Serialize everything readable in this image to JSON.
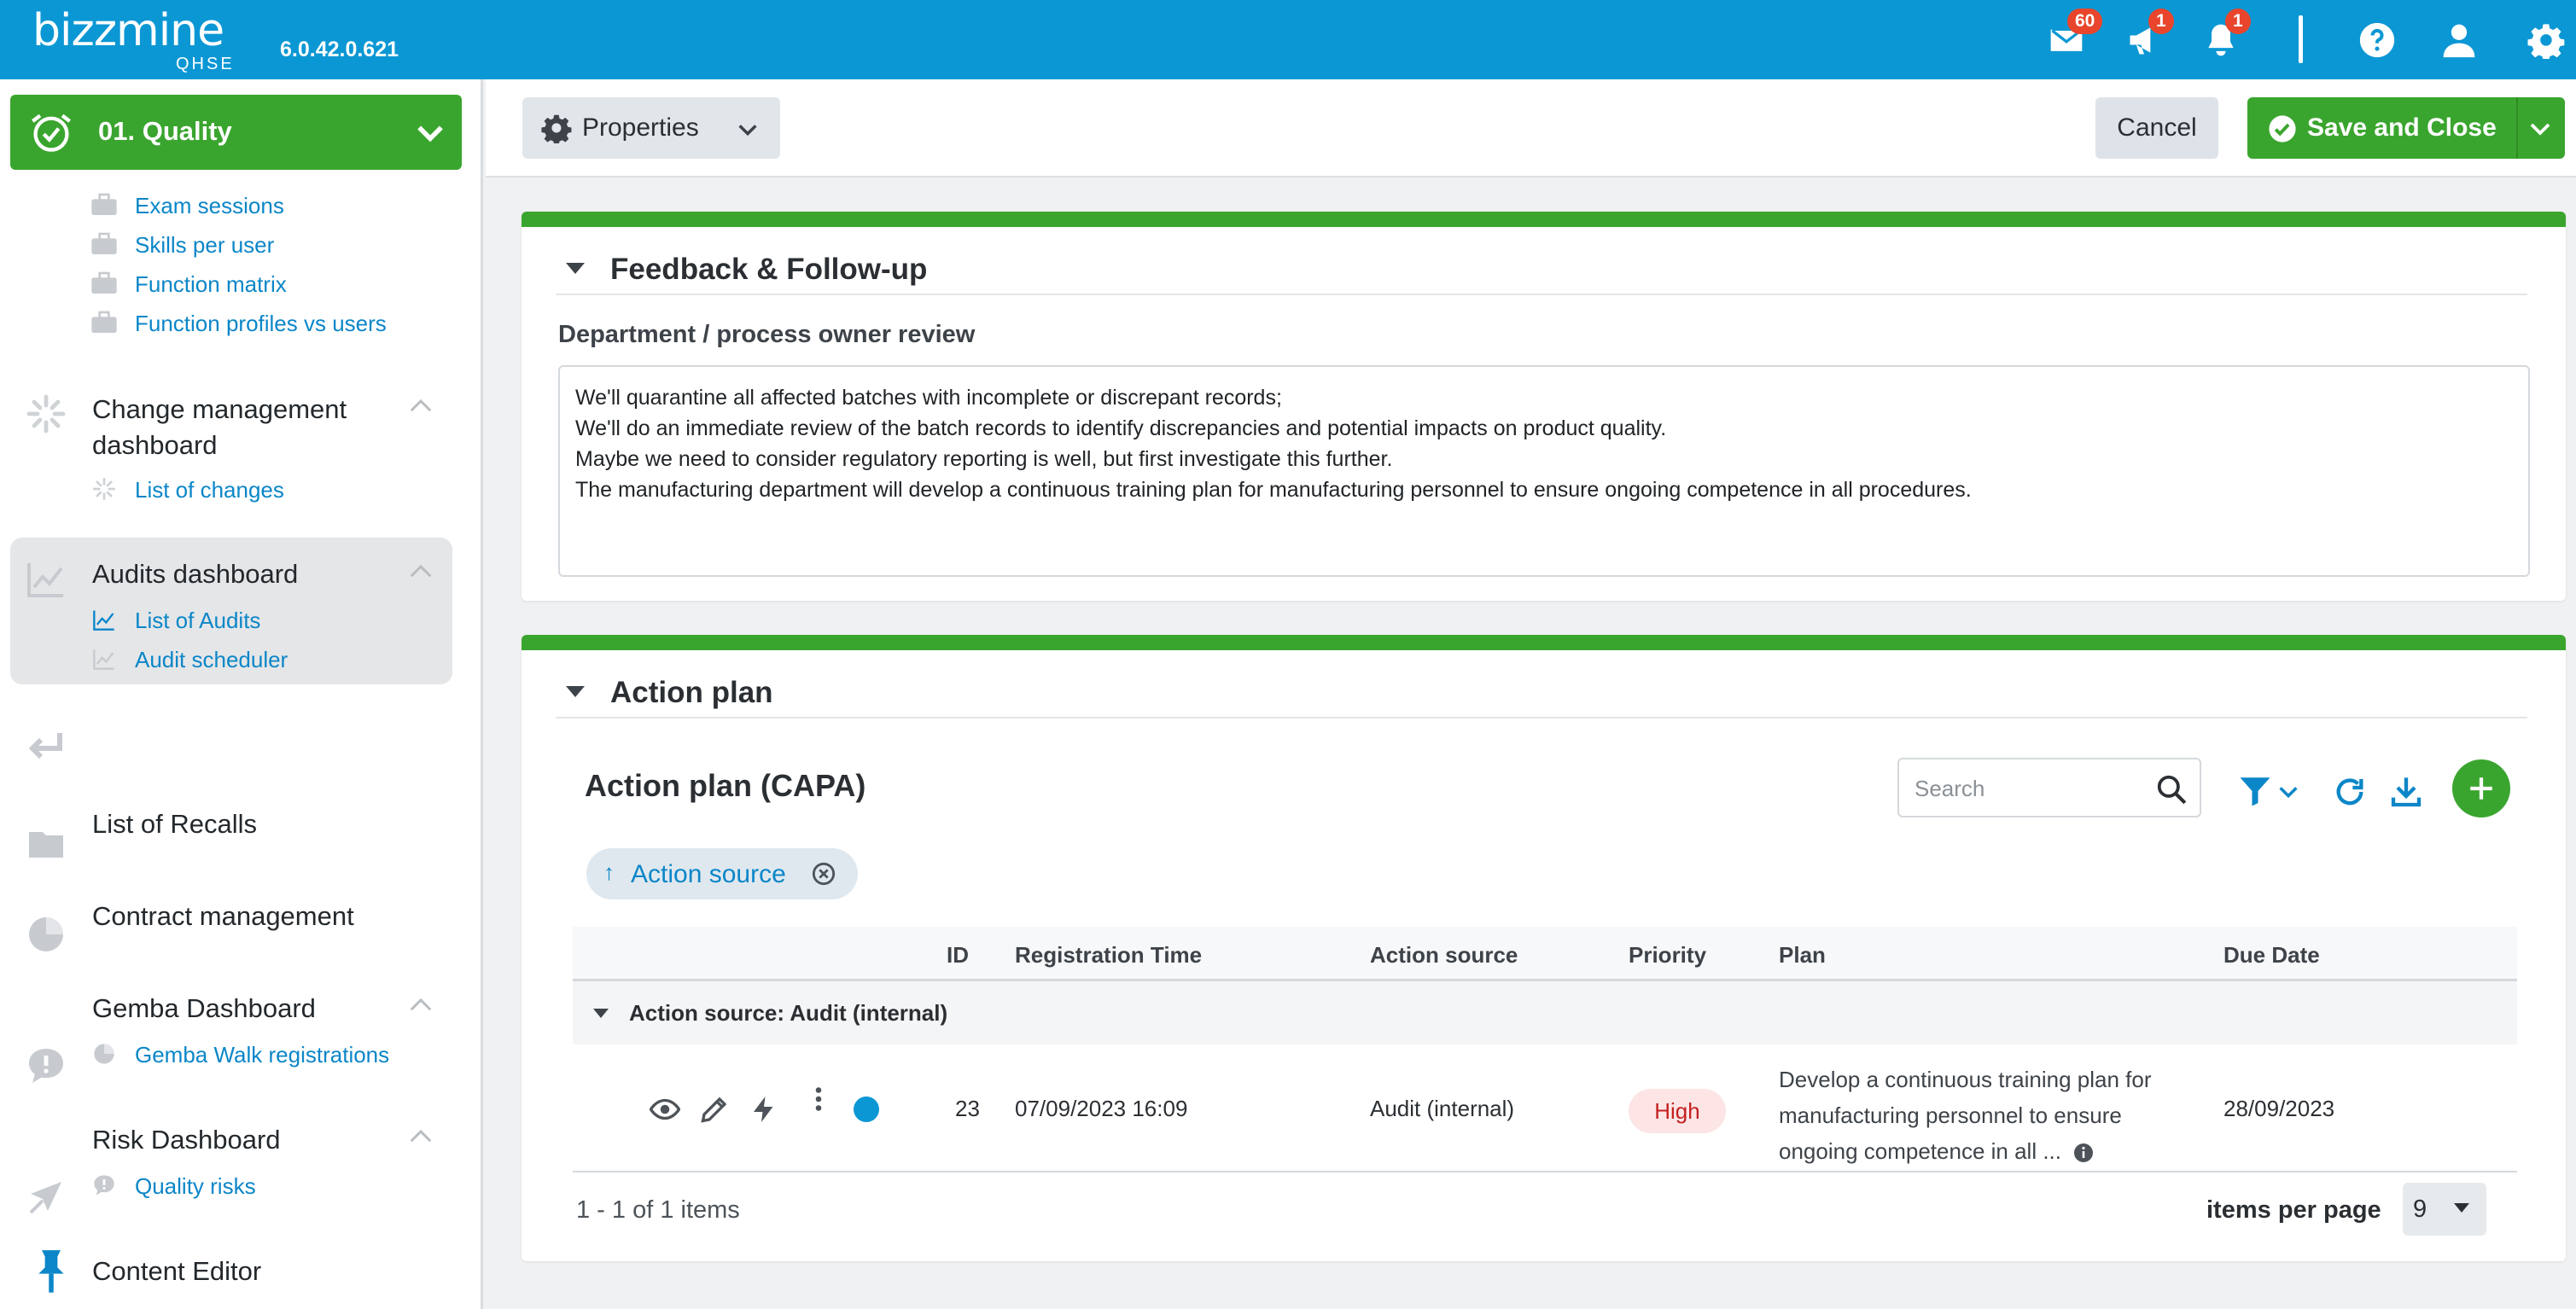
{
  "app": {
    "logo": "bizzmine",
    "logo_sub": "QHSE",
    "version": "6.0.42.0.621",
    "badges": {
      "mail": "60",
      "announcements": "1",
      "notifications": "1"
    },
    "accent": "#0b97d4",
    "green": "#3aa52e"
  },
  "sidebar": {
    "module": "01. Quality",
    "quality_links": [
      "Exam sessions",
      "Skills per user",
      "Function matrix",
      "Function profiles vs users"
    ],
    "change_title": "Change management dashboard",
    "change_title_line1": "Change management",
    "change_title_line2": "dashboard",
    "change_links": [
      "List of changes"
    ],
    "audits_title": "Audits dashboard",
    "audits_links": [
      "List of Audits",
      "Audit scheduler"
    ],
    "recalls": "List of Recalls",
    "contracts": "Contract management",
    "gemba_title": "Gemba Dashboard",
    "gemba_links": [
      "Gemba Walk registrations"
    ],
    "risk_title": "Risk Dashboard",
    "risk_links": [
      "Quality risks"
    ],
    "content_editor": "Content Editor"
  },
  "toolbar": {
    "properties": "Properties",
    "cancel": "Cancel",
    "save_close": "Save and Close"
  },
  "feedback": {
    "title": "Feedback & Follow-up",
    "field_label": "Department / process owner review",
    "lines": [
      "We'll quarantine all affected batches with incomplete or discrepant records;",
      "We'll do an immediate review of the batch records to identify discrepancies and potential impacts on product quality.",
      "Maybe we need to consider regulatory reporting is well, but first investigate this further.",
      "The manufacturing department will develop a continuous training plan for manufacturing personnel to ensure ongoing competence in all procedures."
    ]
  },
  "action_plan": {
    "title": "Action plan",
    "grid_title": "Action plan (CAPA)",
    "search_placeholder": "Search",
    "group_chip": "Action source",
    "columns": [
      "ID",
      "Registration Time",
      "Action source",
      "Priority",
      "Plan",
      "Due Date"
    ],
    "group_label": "Action source:  Audit (internal)",
    "rows": [
      {
        "id": "23",
        "registration_time": "07/09/2023 16:09",
        "action_source": "Audit (internal)",
        "priority": "High",
        "plan_lines": [
          "Develop a continuous training plan for",
          "manufacturing personnel to ensure",
          "ongoing competence in all ..."
        ],
        "due_date": "28/09/2023"
      }
    ],
    "pager_info": "1 - 1 of 1 items",
    "items_per_page_label": "items per page",
    "items_per_page": "9"
  }
}
